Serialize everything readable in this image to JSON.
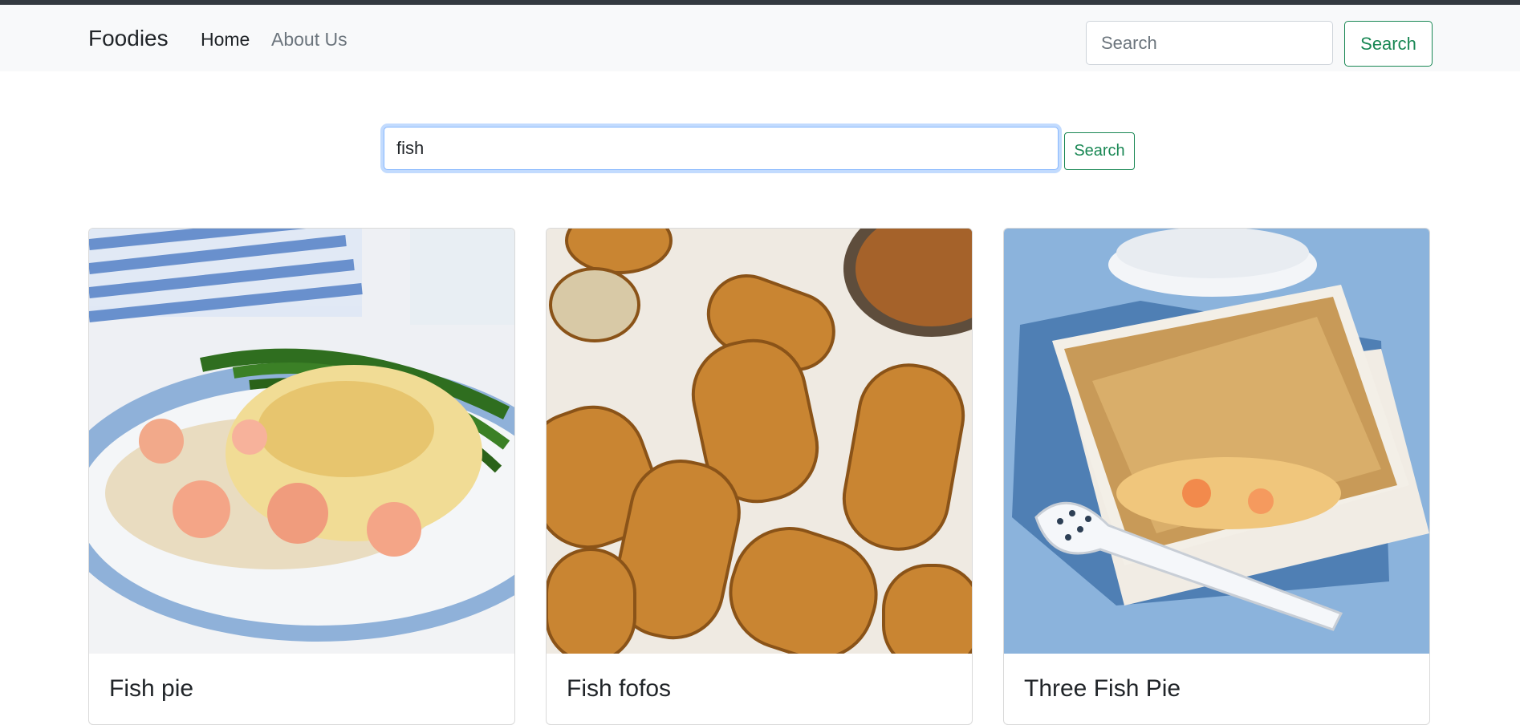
{
  "navbar": {
    "brand": "Foodies",
    "links": [
      "Home",
      "About Us"
    ],
    "search_placeholder": "Search",
    "search_button": "Search"
  },
  "main_search": {
    "value": "fish",
    "button": "Search"
  },
  "results": [
    {
      "title": "Fish pie",
      "image": "fish-pie-photo"
    },
    {
      "title": "Fish fofos",
      "image": "fish-fofos-photo"
    },
    {
      "title": "Three Fish Pie",
      "image": "three-fish-pie-photo"
    }
  ],
  "colors": {
    "navbar_bg": "#f8f9fa",
    "success": "#198754",
    "focus_ring": "#86b7fe",
    "muted_link": "#6c757d"
  }
}
